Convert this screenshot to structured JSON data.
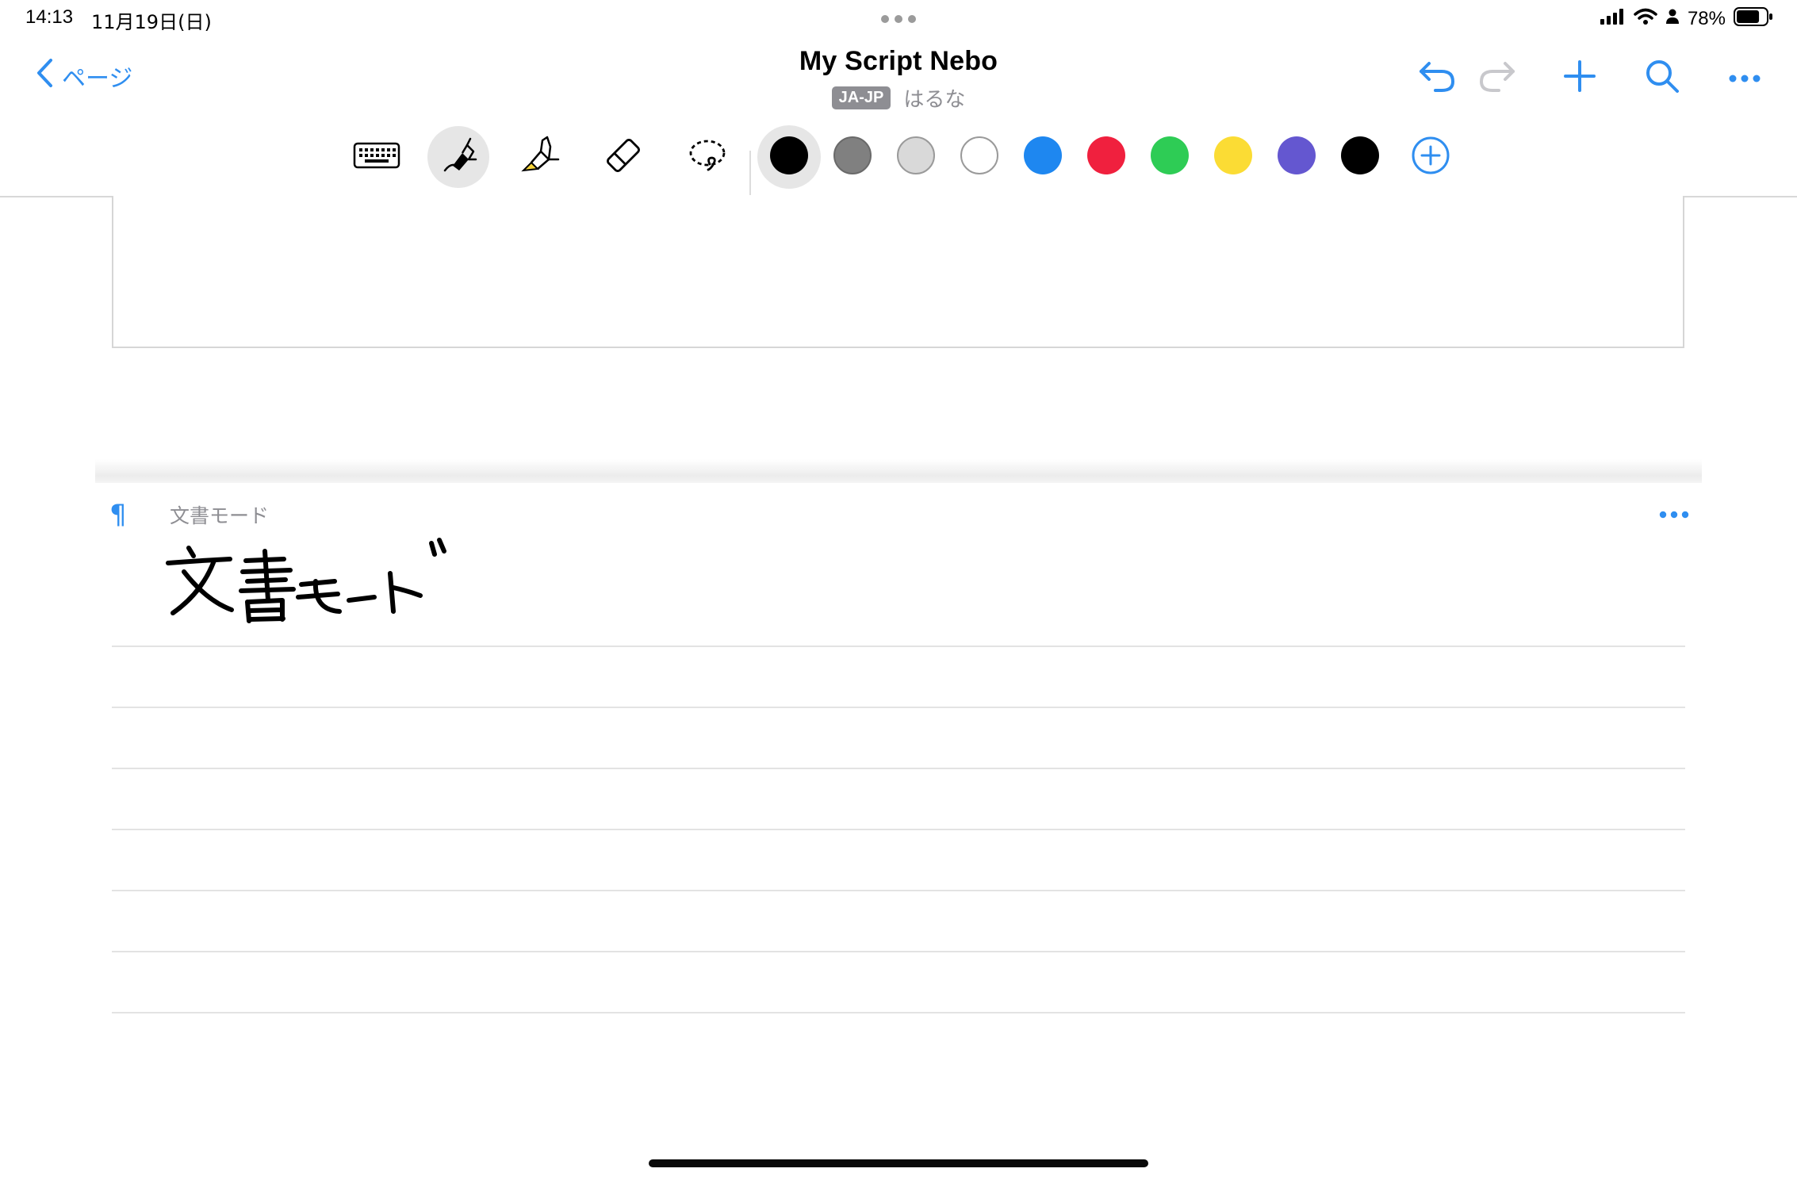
{
  "status": {
    "time": "14:13",
    "date": "11月19日(日)",
    "battery_percent": "78%",
    "battery_level": 0.78
  },
  "nav": {
    "back_label": "ページ",
    "title": "My Script Nebo",
    "language_badge": "JA-JP",
    "author": "はるな"
  },
  "toolbar": {
    "tools": [
      "keyboard-icon",
      "pen-icon",
      "highlighter-icon",
      "eraser-icon",
      "lasso-icon"
    ],
    "selected_tool": "pen",
    "colors": [
      "#000000",
      "#808080",
      "#d9d9d9",
      "#ffffff",
      "#1e87f0",
      "#f0203e",
      "#2ecc55",
      "#fbdc34",
      "#6457d0",
      "#000000"
    ],
    "selected_color_index": 0,
    "accent": "#2f8ef0"
  },
  "document": {
    "section_label": "文書モード",
    "handwritten_text": "文書モード"
  }
}
